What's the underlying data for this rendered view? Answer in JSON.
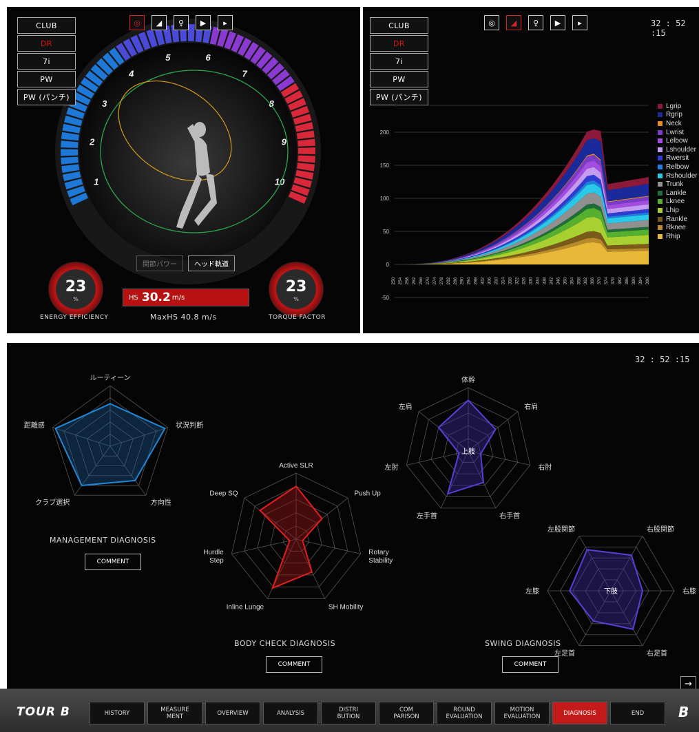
{
  "clock": "32 : 52 :15",
  "clubs": [
    "CLUB",
    "DR",
    "7i",
    "PW",
    "PW (パンチ)"
  ],
  "left": {
    "scale": [
      "1",
      "2",
      "3",
      "4",
      "5",
      "6",
      "7",
      "8",
      "9",
      "10"
    ],
    "energy_value": "23",
    "energy_unit": "%",
    "energy_label": "ENERGY EFFICIENCY",
    "torque_value": "23",
    "torque_unit": "%",
    "torque_label": "TORQUE FACTOR",
    "btn_power": "関節パワー",
    "btn_head": "ヘッド軌道",
    "hs_label": "HS",
    "hs_value": "30.2",
    "hs_unit": "m/s",
    "maxhs": "MaxHS 40.8 m/s"
  },
  "chart_data": {
    "type": "area",
    "series": [
      {
        "name": "Lgrip",
        "color": "#8b1a3a"
      },
      {
        "name": "Rgrip",
        "color": "#1a2a9b"
      },
      {
        "name": "Neck",
        "color": "#e38a2a"
      },
      {
        "name": "Lwrist",
        "color": "#7a3cc8"
      },
      {
        "name": "Lelbow",
        "color": "#a24ce0"
      },
      {
        "name": "Lshoulder",
        "color": "#c49bf0"
      },
      {
        "name": "Rwersit",
        "color": "#2f3cd0"
      },
      {
        "name": "Relbow",
        "color": "#1f7fe0"
      },
      {
        "name": "Rshoulder",
        "color": "#2ac8e8"
      },
      {
        "name": "Trunk",
        "color": "#909090"
      },
      {
        "name": "Lankle",
        "color": "#1f6e3a"
      },
      {
        "name": "Lknee",
        "color": "#55b030"
      },
      {
        "name": "Lhip",
        "color": "#a8d030"
      },
      {
        "name": "Rankle",
        "color": "#7a5a1a"
      },
      {
        "name": "Rknee",
        "color": "#b88a2a"
      },
      {
        "name": "Rhip",
        "color": "#e8b838"
      }
    ],
    "yticks": [
      "200",
      "150",
      "100",
      "50",
      "0",
      "-50"
    ],
    "xticks": [
      "250",
      "254",
      "258",
      "262",
      "266",
      "270",
      "274",
      "278",
      "282",
      "286",
      "290",
      "294",
      "298",
      "302",
      "306",
      "310",
      "314",
      "318",
      "322",
      "326",
      "330",
      "334",
      "338",
      "342",
      "346",
      "350",
      "354",
      "358",
      "362",
      "366",
      "370",
      "374",
      "378",
      "382",
      "386",
      "390",
      "394",
      "398"
    ]
  },
  "management": {
    "labels": [
      "ルーティーン",
      "状況判断",
      "方向性",
      "クラブ選択",
      "距離感"
    ],
    "values": [
      0.7,
      0.95,
      0.7,
      0.8,
      0.95
    ],
    "title": "MANAGEMENT DIAGNOSIS",
    "comment": "COMMENT"
  },
  "body": {
    "labels": [
      "Active SLR",
      "Push Up",
      "Rotary\nStability",
      "SH Mobility",
      "Inline Lunge",
      "Hurdle\nStep",
      "Deep SQ"
    ],
    "values": [
      0.8,
      0.5,
      0.1,
      0.55,
      0.82,
      0.1,
      0.7
    ],
    "title": "BODY CHECK DIAGNOSIS",
    "comment": "COMMENT"
  },
  "swing_upper": {
    "labels": [
      "体幹",
      "右肩",
      "右肘",
      "右手首",
      "左手首",
      "左肘",
      "左肩"
    ],
    "values": [
      0.8,
      0.55,
      0.2,
      0.55,
      0.75,
      0.15,
      0.6
    ],
    "center": "上肢"
  },
  "swing_lower": {
    "labels": [
      "左股関節",
      "右股関節",
      "右膝",
      "右足首",
      "左足首",
      "左膝"
    ],
    "values": [
      0.75,
      0.65,
      0.5,
      0.7,
      0.55,
      0.65
    ],
    "center": "下肢"
  },
  "swing_title": "SWING DIAGNOSIS",
  "swing_comment": "COMMENT",
  "nav": {
    "brand": "TOUR B",
    "items": [
      "HISTORY",
      "MEASURE\nMENT",
      "OVERVIEW",
      "ANALYSIS",
      "DISTRI\nBUTION",
      "COM\nPARISON",
      "ROUND\nEVALUATION",
      "MOTION\nEVALUATION",
      "DIAGNOSIS",
      "END"
    ],
    "active": "DIAGNOSIS",
    "logo": "B"
  },
  "arrow": "→"
}
